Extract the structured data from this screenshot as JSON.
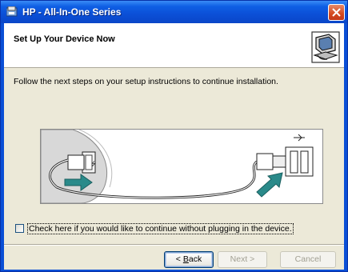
{
  "window": {
    "title": "HP - All-In-One Series",
    "close_icon": "close-icon"
  },
  "header": {
    "title": "Set Up Your Device Now",
    "icon": "computer-device-icon"
  },
  "body": {
    "instruction": "Follow the next steps on your setup instructions to continue installation.",
    "illustration": "usb-cable-connection-illustration"
  },
  "checkbox": {
    "label": "Check here if you would like to continue without plugging in the device.",
    "checked": false
  },
  "buttons": {
    "back_prefix": "< ",
    "back_accel": "B",
    "back_rest": "ack",
    "next": "Next >",
    "cancel": "Cancel"
  },
  "colors": {
    "titlebar": "#0a4fd6",
    "dialog_bg": "#ece9d8",
    "arrow": "#2a8a8a"
  }
}
